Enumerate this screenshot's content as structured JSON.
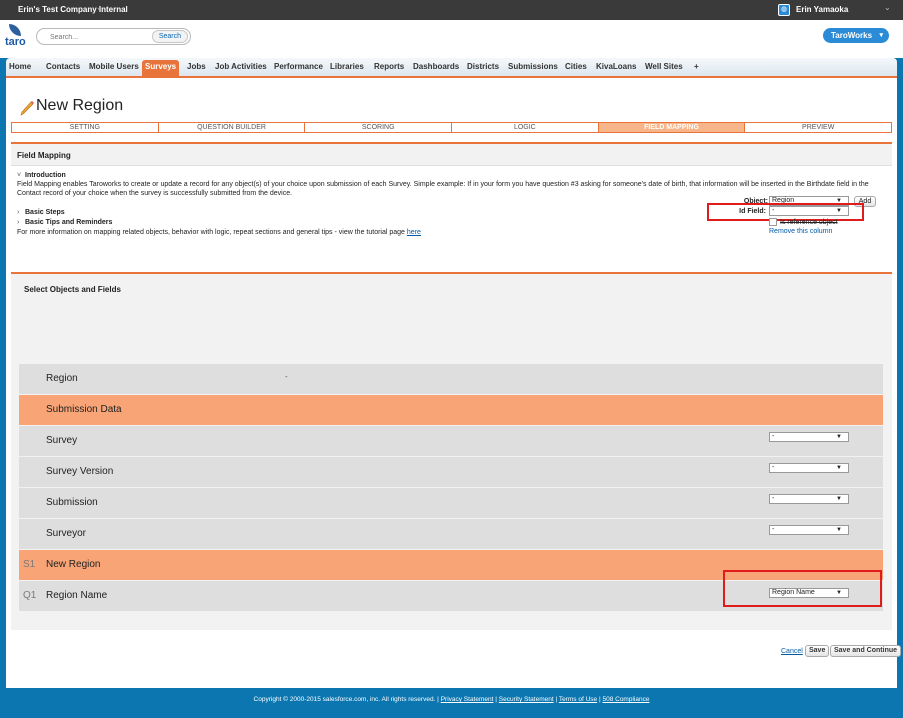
{
  "topbar": {
    "org_name": "Erin's Test Company Internal",
    "user_name": "Erin Yamaoka"
  },
  "header": {
    "logo_text": "taro",
    "search_placeholder": "Search...",
    "search_button": "Search",
    "app_name": "TaroWorks"
  },
  "tabs": [
    "Home",
    "Contacts",
    "Mobile Users",
    "Surveys",
    "Jobs",
    "Job Activities",
    "Performance",
    "Libraries",
    "Reports",
    "Dashboards",
    "Districts",
    "Submissions",
    "Cities",
    "KivaLoans",
    "Well Sites",
    "+"
  ],
  "active_tab": "Surveys",
  "page_title": "New Region",
  "wizard_steps": [
    "SETTING",
    "QUESTION BUILDER",
    "SCORING",
    "LOGIC",
    "FIELD MAPPING",
    "PREVIEW"
  ],
  "field_mapping": {
    "title": "Field Mapping",
    "intro_heading": "Introduction",
    "intro_text": "Field Mapping enables Taroworks to create or update a record for any object(s) of your choice upon submission of each Survey. Simple example: If in your form you have question #3 asking for someone's date of birth, that information will be inserted in the Birthdate field in the Contact record of your choice when the survey is successfully submitted from the device.",
    "basic_steps": "Basic Steps",
    "basic_tips": "Basic Tips and Reminders",
    "more_info_text": "For more information on mapping related objects, behavior with logic, repeat sections and general tips - view the tutorial page",
    "more_info_link": "here"
  },
  "objects_panel": {
    "title": "Select Objects and Fields",
    "object_label": "Object:",
    "object_value": "Region",
    "add_button": "Add",
    "id_field_label": "Id Field:",
    "id_field_value": "-",
    "reference_label": "Is reference object",
    "remove_link": "Remove this column"
  },
  "mapping_rows": {
    "region": {
      "label": "Region",
      "value": "-"
    },
    "submission_data": {
      "label": "Submission Data"
    },
    "survey": {
      "label": "Survey",
      "select": "-"
    },
    "survey_version": {
      "label": "Survey Version",
      "select": "-"
    },
    "submission": {
      "label": "Submission",
      "select": "-"
    },
    "surveyor": {
      "label": "Surveyor",
      "select": "-"
    },
    "s1": {
      "prefix": "S1",
      "label": "New Region"
    },
    "q1": {
      "prefix": "Q1",
      "label": "Region Name",
      "select": "Region Name"
    }
  },
  "actions": {
    "cancel": "Cancel",
    "save": "Save",
    "save_continue": "Save and Continue"
  },
  "footer": {
    "copyright": "Copyright © 2000-2015 salesforce.com, inc. All rights reserved. |",
    "privacy": "Privacy Statement",
    "security": "Security Statement",
    "terms": "Terms of Use",
    "compliance": "508 Compliance"
  },
  "colors": {
    "accent": "#e8743b",
    "highlight_row": "#f8a477",
    "brand_blue": "#0b76b0",
    "annotation_red": "#e01b1b"
  }
}
